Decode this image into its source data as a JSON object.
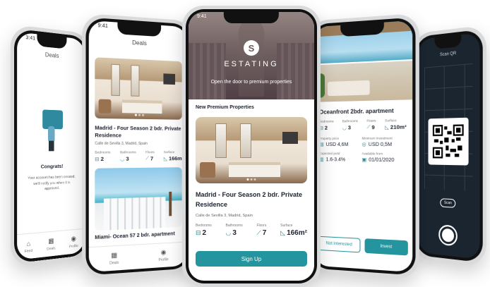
{
  "phone_left": {
    "time": "3:41",
    "header": "Deals",
    "illustration_icon": "presenter-illustration",
    "title": "Congrats!",
    "message": "Your account has been created, we'll notify you when it is approved.",
    "tabs": [
      {
        "icon": "home-icon",
        "label": "Feed"
      },
      {
        "icon": "deals-icon",
        "label": "Deals"
      },
      {
        "icon": "profile-icon",
        "label": "Profile"
      }
    ]
  },
  "phone_deals": {
    "time": "9:41",
    "header": "Deals",
    "card1": {
      "name": "Madrid - Four Season 2 bdr. Private Residence",
      "address": "Calle de Sevilla 3, Madrid, Spain",
      "specs": [
        {
          "label": "Bedrooms",
          "icon": "bed-icon",
          "value": "2"
        },
        {
          "label": "Bathrooms",
          "icon": "bath-icon",
          "value": "3"
        },
        {
          "label": "Floors",
          "icon": "stairs-icon",
          "value": "7"
        },
        {
          "label": "Surface",
          "icon": "ruler-icon",
          "value": "166m"
        }
      ]
    },
    "card2": {
      "name": "Miami- Ocean 57 2 bdr. apartment"
    },
    "tabs": [
      {
        "icon": "deals-icon",
        "label": "Deals"
      },
      {
        "icon": "profile-icon",
        "label": "Profile"
      }
    ]
  },
  "phone_center": {
    "time": "9:41",
    "brand": "ESTATING",
    "tagline": "Open the door to premium properties",
    "section_title": "New Premium Properties",
    "property": {
      "name": "Madrid - Four Season 2 bdr. Private Residence",
      "address": "Calle de Sevilla 3, Madrid, Spain",
      "specs": [
        {
          "label": "Bedrooms",
          "icon": "bed-icon",
          "value": "2"
        },
        {
          "label": "Bathrooms",
          "icon": "bath-icon",
          "value": "3"
        },
        {
          "label": "Floors",
          "icon": "stairs-icon",
          "value": "7"
        },
        {
          "label": "Surface",
          "icon": "ruler-icon",
          "value": "166m²"
        }
      ]
    },
    "signup_label": "Sign Up",
    "accent": "#24949f"
  },
  "phone_right": {
    "title": "Oceanfront 2bdr. apartment",
    "specs": [
      {
        "label": "Bedrooms",
        "icon": "bed-icon",
        "value": "2"
      },
      {
        "label": "Bathrooms",
        "icon": "bath-icon",
        "value": "3"
      },
      {
        "label": "Floors",
        "icon": "stairs-icon",
        "value": "9"
      },
      {
        "label": "Surface",
        "icon": "ruler-icon",
        "value": "210m²"
      }
    ],
    "finance": [
      {
        "label": "Property price",
        "icon": "money-icon",
        "value": "USD 4,6M"
      },
      {
        "label": "Minimum investment",
        "icon": "coins-icon",
        "value": "USD 0,5M"
      },
      {
        "label": "Expected yield",
        "icon": "chart-icon",
        "value": "1.6-3.4%"
      },
      {
        "label": "Available from",
        "icon": "calendar-icon",
        "value": "01/01/2020"
      }
    ],
    "secondary_button": "Not Interested",
    "primary_button": "Invest"
  },
  "phone_far_right": {
    "header": "Scan QR",
    "scan_label": "Scan",
    "qr_icon": "qr-code-icon"
  }
}
